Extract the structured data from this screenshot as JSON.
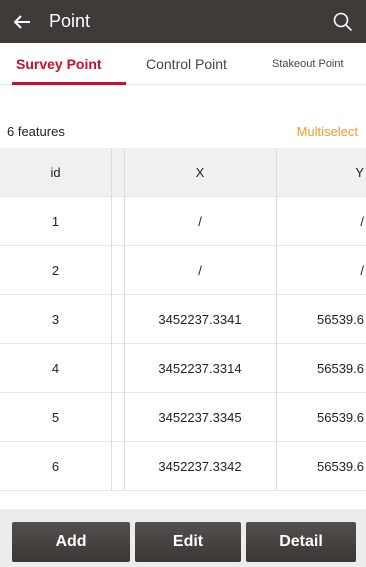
{
  "app_bar": {
    "title": "Point",
    "back_icon": "arrow-left-icon",
    "search_icon": "search-icon"
  },
  "tabs": [
    {
      "label": "Survey Point",
      "active": true
    },
    {
      "label": "Control Point",
      "active": false
    },
    {
      "label": "Stakeout Point",
      "active": false
    }
  ],
  "info": {
    "count": "6 features",
    "multiselect": "Multiselect"
  },
  "table": {
    "headers": {
      "id": "id",
      "x": "X",
      "y": "Y"
    },
    "rows": [
      {
        "id": "1",
        "x": "/",
        "y": "/"
      },
      {
        "id": "2",
        "x": "/",
        "y": "/"
      },
      {
        "id": "3",
        "x": "3452237.3341",
        "y": "56539.6"
      },
      {
        "id": "4",
        "x": "3452237.3314",
        "y": "56539.6"
      },
      {
        "id": "5",
        "x": "3452237.3345",
        "y": "56539.6"
      },
      {
        "id": "6",
        "x": "3452237.3342",
        "y": "56539.6"
      }
    ]
  },
  "buttons": {
    "add": "Add",
    "edit": "Edit",
    "detail": "Detail"
  },
  "colors": {
    "app_bar": "#3e3a38",
    "accent": "#c8102e",
    "multiselect": "#ed9c30"
  }
}
